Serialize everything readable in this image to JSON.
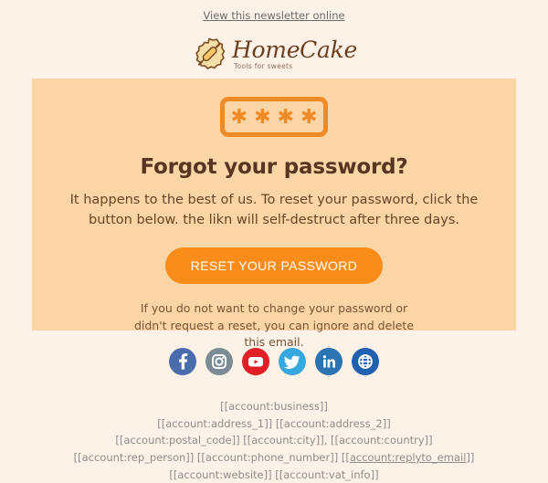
{
  "preheader": {
    "link_label": "View this newsletter online"
  },
  "logo": {
    "icon_name": "rolling-pin-badge-icon",
    "wordmark": "HomeCake",
    "tagline": "Tools for sweets"
  },
  "card": {
    "password_icon_name": "password-asterisks-icon",
    "password_mask": "✱",
    "title": "Forgot your password?",
    "body": "It happens to the best of us. To reset your password, click the button below. the likn will self-destruct after three days.",
    "cta_label": "RESET YOUR PASSWORD",
    "note": "If you do not want to change your password or didn't request a reset, you can ignore and delete this email."
  },
  "social": [
    {
      "name": "facebook-icon",
      "label": "Facebook",
      "color": "#4a6cad"
    },
    {
      "name": "instagram-icon",
      "label": "Instagram",
      "color": "#7a8c94"
    },
    {
      "name": "youtube-icon",
      "label": "YouTube",
      "color": "#e11f26"
    },
    {
      "name": "twitter-icon",
      "label": "Twitter",
      "color": "#36a8e0"
    },
    {
      "name": "linkedin-icon",
      "label": "LinkedIn",
      "color": "#2a74b4"
    },
    {
      "name": "website-globe-icon",
      "label": "Website",
      "color": "#2160ae"
    }
  ],
  "footer": {
    "line1": "[[account:business]]",
    "line2": "[[account:address_1]] [[account:address_2]]",
    "line3": "[[account:postal_code]] [[account:city]], [[account:country]]",
    "line4_prefix": "[[account:rep_person]] [[account:phone_number]] ",
    "line4_link": "[[account:replyto_email]]",
    "line5": "[[account:website]] [[account:vat_info]]"
  },
  "colors": {
    "page_background": "#fdf2e7",
    "card_background": "#fad5a5",
    "accent_orange": "#fa8c19",
    "heading_brown": "#5a3420",
    "body_brown": "#6b4326",
    "footer_gray": "#8d8d8d"
  }
}
